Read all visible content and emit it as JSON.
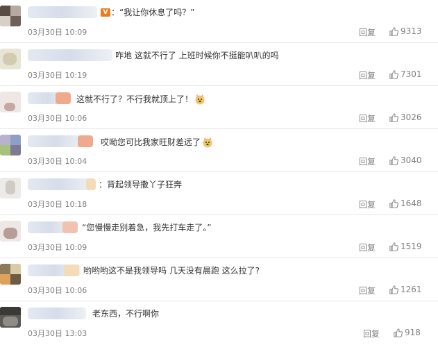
{
  "reply_label": "回复",
  "comments": [
    {
      "text": "：“我让你休息了吗？”",
      "time": "03月30日 10:09",
      "likes": "9313",
      "vip_badge": "V"
    },
    {
      "text": "咋地 这就不行了 上班时候你不挺能叭叭的吗",
      "time": "03月30日 10:19",
      "likes": "7301"
    },
    {
      "text": "这就不行了？不行我就顶上了！",
      "time": "03月30日 10:06",
      "likes": "3026",
      "emoji": "doge-icon"
    },
    {
      "text": "哎呦您可比我家旺财差远了",
      "time": "03月30日 10:04",
      "likes": "3040",
      "emoji": "doge-icon"
    },
    {
      "text": "：背起领导撒丫子狂奔",
      "time": "03月30日 10:18",
      "likes": "1648"
    },
    {
      "text": "“您慢慢走别着急，我先打车走了。”",
      "time": "03月30日 10:09",
      "likes": "1519"
    },
    {
      "text": "哟哟哟这不是我领导吗 几天没有晨跑 这么拉了?",
      "time": "03月30日 10:06",
      "likes": "1261"
    },
    {
      "text": "老东西，不行啊你",
      "time": "03月30日 13:03",
      "likes": "918"
    }
  ],
  "colors": {
    "text": "#333333",
    "meta": "#808080",
    "divider": "#e6e6e6",
    "vip": "#f27a1a"
  }
}
